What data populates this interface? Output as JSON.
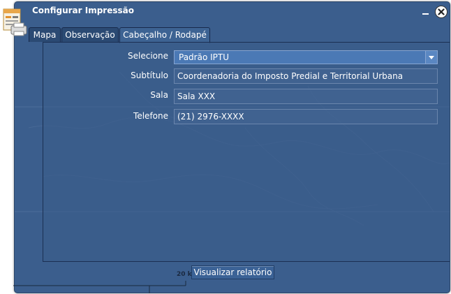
{
  "window": {
    "title": "Configurar Impressão"
  },
  "tabs": [
    {
      "label": "Mapa",
      "active": false
    },
    {
      "label": "Observação",
      "active": false
    },
    {
      "label": "Cabeçalho / Rodapé",
      "active": true
    }
  ],
  "form": {
    "selecione": {
      "label": "Selecione",
      "value": "Padrão IPTU"
    },
    "subtitulo": {
      "label": "Subtítulo",
      "value": "Coordenadoria do Imposto Predial e Territorial Urbana"
    },
    "sala": {
      "label": "Sala",
      "value": "Sala XXX"
    },
    "telefone": {
      "label": "Telefone",
      "value": "(21) 2976-XXXX"
    }
  },
  "actions": {
    "preview_label": "Visualizar relatório"
  },
  "map": {
    "scale_label": "20 k"
  },
  "colors": {
    "dialog_bg": "#3b5e8d",
    "tab_active": "#3d6393",
    "select_bg": "#4b79b5"
  }
}
